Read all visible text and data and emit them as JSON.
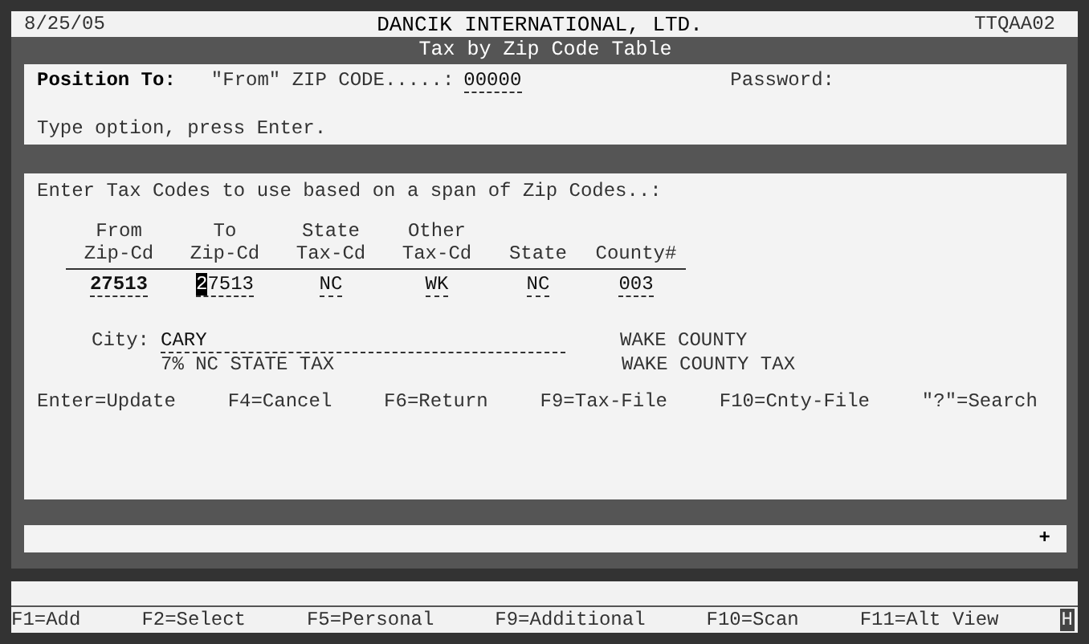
{
  "header": {
    "date": "8/25/05",
    "company": "DANCIK INTERNATIONAL, LTD.",
    "program": "TTQAA02"
  },
  "title": "Tax by Zip Code Table",
  "position": {
    "label": "Position To:",
    "field_label": "\"From\" ZIP CODE.....:",
    "value": "00000",
    "password_label": "Password:"
  },
  "instruction": "Type option, press Enter.",
  "entry": {
    "prompt": "Enter Tax Codes to use based on a span of Zip Codes..:",
    "columns": [
      {
        "line1": "From",
        "line2": "Zip-Cd"
      },
      {
        "line1": "To",
        "line2": "Zip-Cd"
      },
      {
        "line1": "State",
        "line2": "Tax-Cd"
      },
      {
        "line1": "Other",
        "line2": "Tax-Cd"
      },
      {
        "line2": "State"
      },
      {
        "line2": "County#"
      }
    ],
    "fields": [
      {
        "value": "27513",
        "focused": false
      },
      {
        "value": "27513",
        "focused": true
      },
      {
        "value": "NC",
        "focused": false
      },
      {
        "value": "WK",
        "focused": false
      },
      {
        "value": "NC",
        "focused": false
      },
      {
        "value": "003",
        "focused": false
      }
    ],
    "city_label": "City:",
    "city_value": "CARY",
    "state_tax_desc": "7% NC STATE TAX",
    "county_name": "WAKE COUNTY",
    "county_tax_desc": "WAKE COUNTY TAX"
  },
  "function_keys": [
    "Enter=Update",
    "F4=Cancel",
    "F6=Return",
    "F9=Tax-File",
    "F10=Cnty-File",
    "\"?\"=Search"
  ],
  "message_marker": "+",
  "footer_keys": [
    "F1=Add",
    "F2=Select",
    "F5=Personal",
    "F9=Additional",
    "F10=Scan",
    "F11=Alt View"
  ],
  "indicator": "H"
}
